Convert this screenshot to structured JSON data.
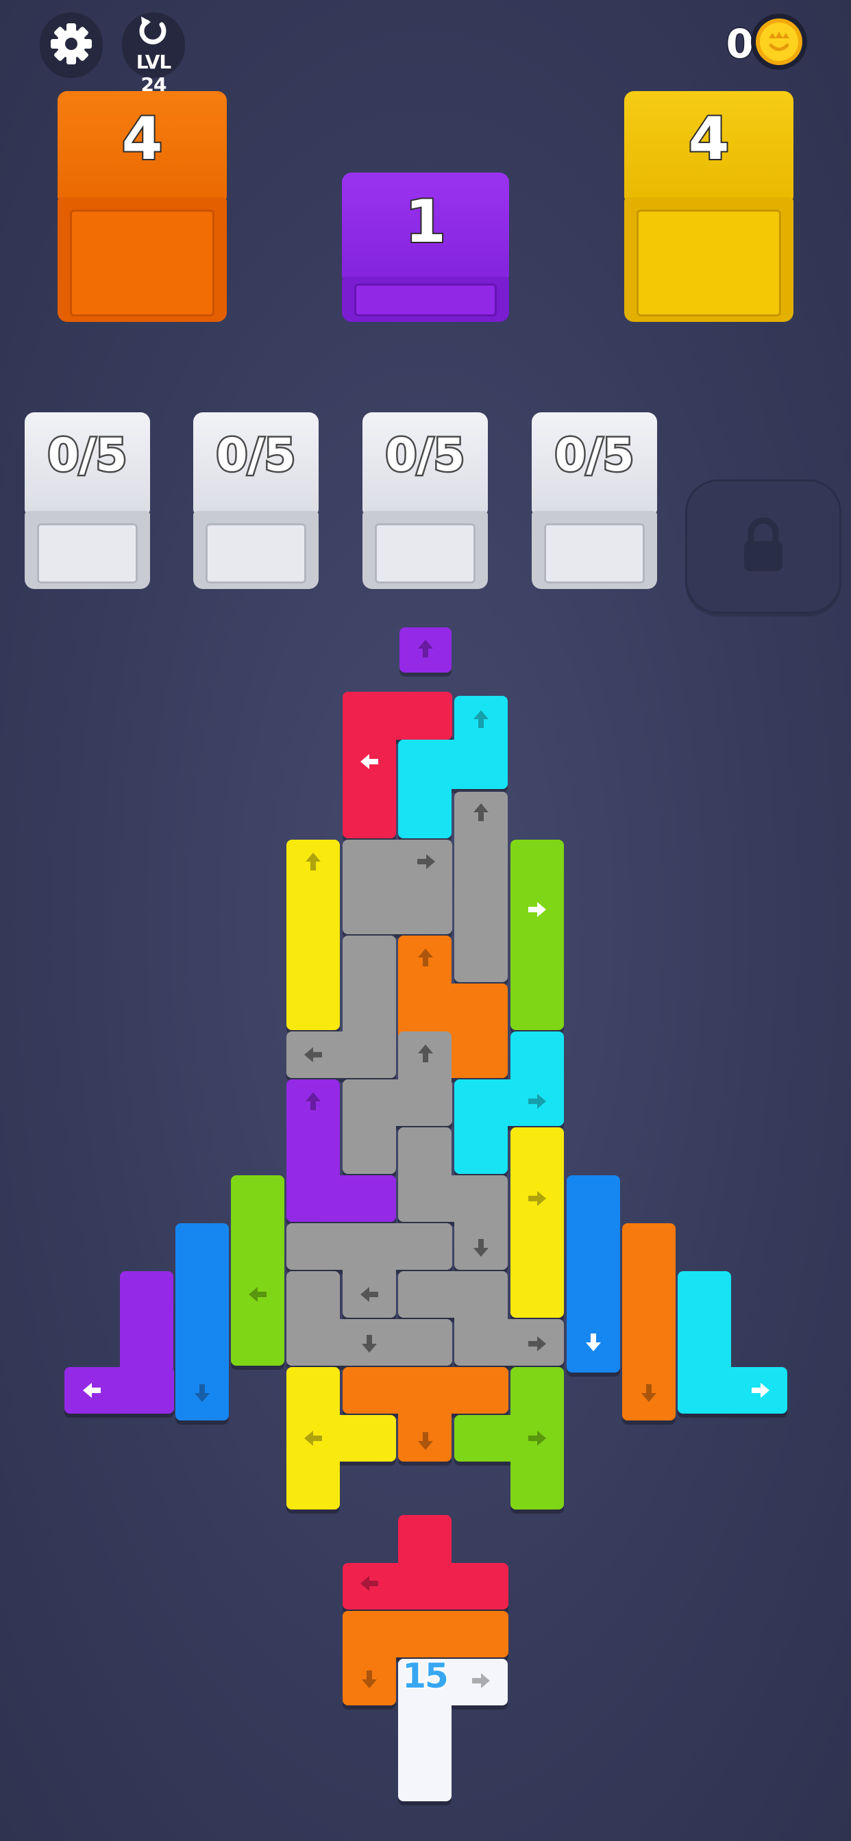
{
  "header": {
    "settings_icon": "gear-icon",
    "restart_icon": "restart-icon",
    "level_label": "LVL 24",
    "coin_count": "0",
    "coin_icon": "coin-icon"
  },
  "goal_boxes": [
    {
      "count": "4",
      "color": "#f57a0a"
    },
    {
      "count": "1",
      "color": "#8b2fe3"
    },
    {
      "count": "4",
      "color": "#f4c70a"
    }
  ],
  "slots": [
    {
      "count": "0/5"
    },
    {
      "count": "0/5"
    },
    {
      "count": "0/5"
    },
    {
      "count": "0/5"
    }
  ],
  "locked_slot_icon": "lock-icon",
  "colors": {
    "red": "#f0244e",
    "cyan": "#19e4f4",
    "gray": "#9a9a9a",
    "yellow": "#f9e90e",
    "green": "#7fd617",
    "orange": "#f67a0a",
    "purple": "#9429e6",
    "blue": "#1986f1",
    "white": "#f4f6fb"
  },
  "queue_counter": "15"
}
